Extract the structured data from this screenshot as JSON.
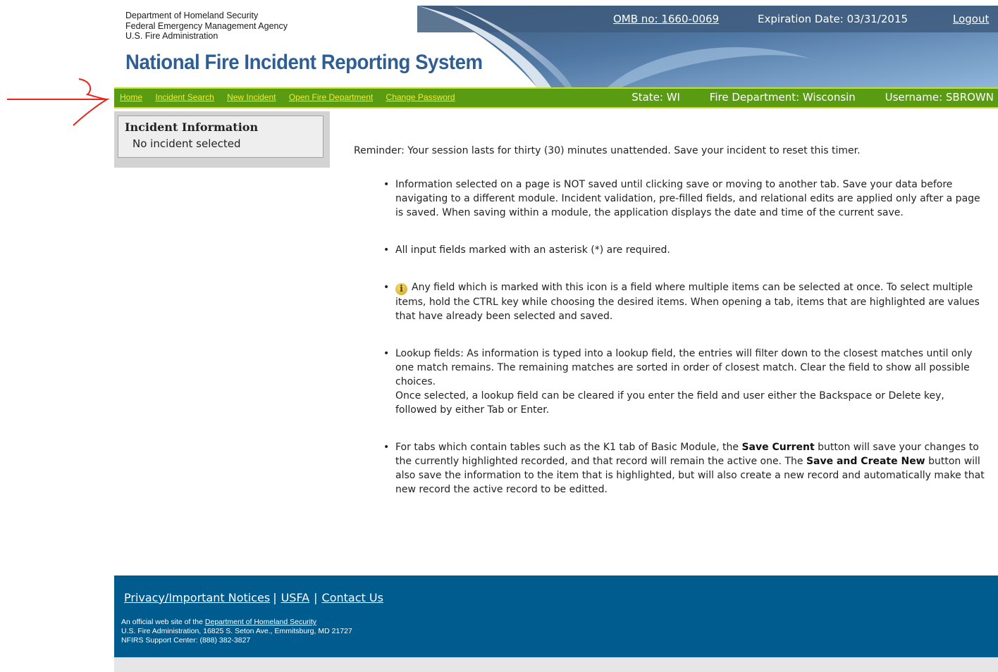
{
  "header": {
    "agency_lines": [
      "Department of Homeland Security",
      "Federal Emergency Management Agency",
      "U.S. Fire Administration"
    ],
    "system_title": "National Fire Incident Reporting System",
    "omb_link": "OMB no: 1660-0069",
    "expiration": "Expiration Date: 03/31/2015",
    "logout": "Logout"
  },
  "nav": {
    "links": [
      "Home",
      "Incident Search",
      "New Incident",
      "Open Fire Department",
      "Change Password"
    ],
    "state": "State: WI",
    "department": "Fire Department: Wisconsin",
    "username": "Username: SBROWN"
  },
  "sidebar": {
    "title": "Incident Information",
    "status": "No incident selected"
  },
  "main": {
    "reminder": "Reminder: Your session lasts for thirty (30) minutes unattended. Save your incident to reset this timer.",
    "tips": {
      "t1": "Information selected on a page is NOT saved until clicking save or moving to another tab. Save your data before navigating to a different module. Incident validation, pre-filled fields, and relational edits are applied only after a page is saved. When saving within a module, the application displays the date and time of the current save.",
      "t2": "All input fields marked with an asterisk (*) are required.",
      "t3": "Any field which is marked with this icon is a field where multiple items can be selected at once. To select multiple items, hold the CTRL key while choosing the desired items. When opening a tab, items that are highlighted are values that have already been selected and saved.",
      "t4_a": "Lookup fields: As information is typed into a lookup field, the entries will filter down to the closest matches until only one match remains. The remaining matches are sorted in order of closest match. Clear the field to show all possible choices.",
      "t4_b": "Once selected, a lookup field can be cleared if you enter the field and user either the Backspace or Delete key, followed by either Tab or Enter.",
      "t5_pre": "For tabs which contain tables such as the K1 tab of Basic Module, the",
      "t5_bold1": "Save Current",
      "t5_mid": "button will save your changes to the currently highlighted recorded, and that record will remain the active one. The",
      "t5_bold2": "Save and Create New",
      "t5_post": "button will also save the information to the item that is highlighted, but will also create a new record and automatically make that new record the active record to be editted."
    },
    "info_icon_glyph": "i"
  },
  "footer": {
    "privacy": "Privacy/Important Notices",
    "usfa": "USFA",
    "contact": "Contact Us",
    "separator": "|",
    "official_prefix": "An official web site of the",
    "dhs_link": "Department of Homeland Security",
    "address": "U.S. Fire Administration, 16825 S. Seton Ave., Emmitsburg, MD 21727",
    "support": "NFIRS Support Center: (888) 382-3827"
  },
  "colors": {
    "nav_green": "#5a9b14",
    "nav_link_yellow": "#f2ec30",
    "title_blue": "#2e5e94",
    "footer_blue": "#005b8e",
    "header_dark": "#3f5e7c",
    "annotation_red": "#e8241c"
  },
  "icons": {
    "info": "info-icon",
    "annotation": "red-arrow-annotation"
  }
}
